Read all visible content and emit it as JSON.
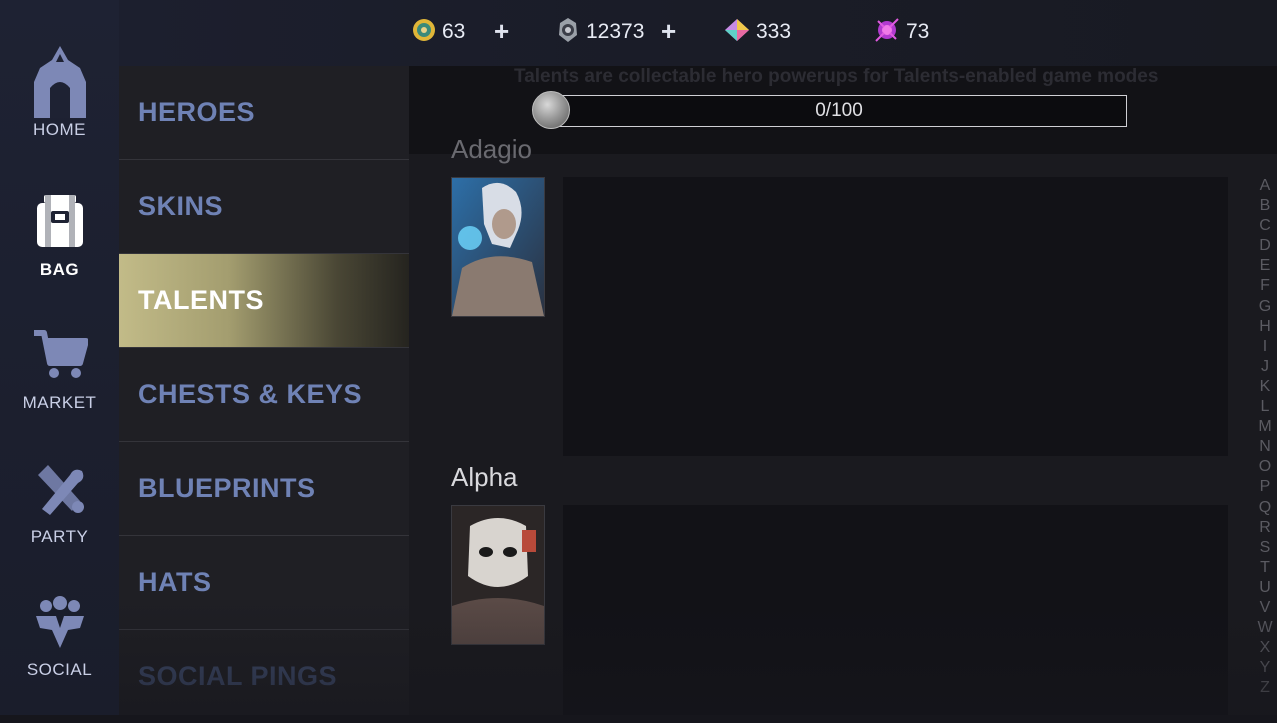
{
  "nav": {
    "items": [
      {
        "label": "HOME",
        "icon": "home-icon",
        "active": false
      },
      {
        "label": "BAG",
        "icon": "bag-icon",
        "active": true
      },
      {
        "label": "MARKET",
        "icon": "cart-icon",
        "active": false
      },
      {
        "label": "PARTY",
        "icon": "party-icon",
        "active": false
      },
      {
        "label": "SOCIAL",
        "icon": "social-icon",
        "active": false
      }
    ]
  },
  "currencies": {
    "gold": {
      "value": "63",
      "icon": "gold-coin-icon"
    },
    "glory": {
      "value": "12373",
      "icon": "glory-icon"
    },
    "ice": {
      "value": "333",
      "icon": "ice-gem-icon"
    },
    "essence": {
      "value": "73",
      "icon": "essence-icon"
    },
    "plus_label": "+"
  },
  "categories": [
    {
      "label": "HEROES",
      "active": false
    },
    {
      "label": "SKINS",
      "active": false
    },
    {
      "label": "TALENTS",
      "active": true
    },
    {
      "label": "CHESTS & KEYS",
      "active": false
    },
    {
      "label": "BLUEPRINTS",
      "active": false
    },
    {
      "label": "HATS",
      "active": false
    },
    {
      "label": "SOCIAL PINGS",
      "active": false
    }
  ],
  "talents": {
    "banner_text": "Talents are collectable hero powerups for Talents-enabled game modes",
    "banner_text_cut": "y",
    "progress_text": "0/100",
    "progress_fraction": 0.0,
    "heroes": [
      {
        "name": "Adagio"
      },
      {
        "name": "Alpha"
      }
    ]
  },
  "alphabet": [
    "A",
    "B",
    "C",
    "D",
    "E",
    "F",
    "G",
    "H",
    "I",
    "J",
    "K",
    "L",
    "M",
    "N",
    "O",
    "P",
    "Q",
    "R",
    "S",
    "T",
    "U",
    "V",
    "W",
    "X",
    "Y",
    "Z"
  ],
  "colors": {
    "accent": "#c2bb88",
    "category_text": "#6f82b5",
    "rail_bg": "#1e2233"
  }
}
